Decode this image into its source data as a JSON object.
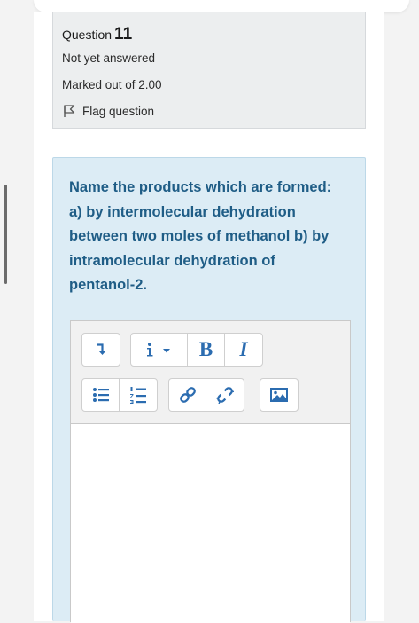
{
  "question": {
    "label": "Question",
    "number": "11",
    "status": "Not yet answered",
    "marks": "Marked out of 2.00",
    "flag_label": "Flag question"
  },
  "question_text": "Name the products which are formed: a) by intermolecular dehydration between two moles of methanol  b) by intramolecular dehydration of pentanol-2.",
  "toolbar": {
    "row1": [
      {
        "name": "toolbar-toggle-button",
        "icon": "arrow-down-icon"
      },
      {
        "name": "paragraph-styles-button",
        "icon": "info-dropdown-icon"
      },
      {
        "name": "bold-button",
        "label": "B"
      },
      {
        "name": "italic-button",
        "label": "I"
      }
    ],
    "row2": [
      {
        "name": "unordered-list-button",
        "icon": "bullet-list-icon"
      },
      {
        "name": "ordered-list-button",
        "icon": "numbered-list-icon"
      },
      {
        "name": "link-button",
        "icon": "link-icon"
      },
      {
        "name": "unlink-button",
        "icon": "unlink-icon"
      },
      {
        "name": "insert-image-button",
        "icon": "image-icon"
      }
    ]
  },
  "colors": {
    "accent": "#2b6cb0",
    "question_text": "#1f5d86",
    "question_bg": "#dcecf5",
    "info_bg": "#eceeef"
  }
}
